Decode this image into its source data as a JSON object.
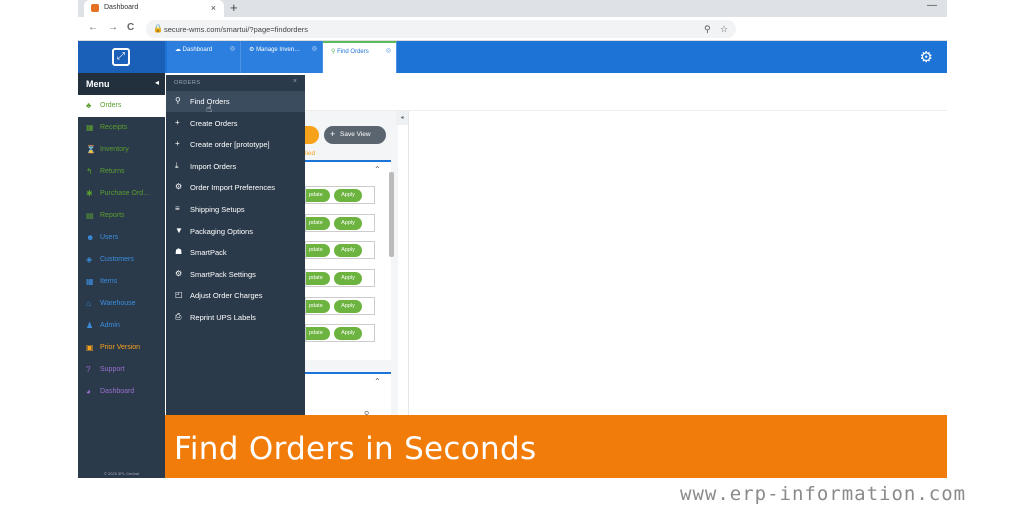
{
  "browser": {
    "tab_title": "Dashboard",
    "tab_close": "×",
    "new_tab": "+",
    "window_minimize": "—",
    "back": "←",
    "forward": "→",
    "reload": "C",
    "url": "secure-wms.com/smartui/?page=findorders",
    "lock_glyph": "🔒",
    "zoom_glyph": "⚲",
    "star_glyph": "☆"
  },
  "app": {
    "logo_glyph": "⤢",
    "tabs": [
      {
        "label": "Dashboard",
        "icon": "☁",
        "close": "◎"
      },
      {
        "label": "Manage Inven…",
        "icon": "⚙",
        "close": "◎"
      },
      {
        "label": "Find Orders",
        "icon": "⚲",
        "close": "◎"
      }
    ],
    "gear_glyph": "⚙"
  },
  "sidebar": {
    "title": "Menu",
    "collapse_glyph": "◂",
    "items": [
      {
        "label": "Orders",
        "icon": "♣",
        "color": "#5a9e2f"
      },
      {
        "label": "Receipts",
        "icon": "▦",
        "color": "#5a9e2f"
      },
      {
        "label": "Inventory",
        "icon": "⌛",
        "color": "#5a9e2f"
      },
      {
        "label": "Returns",
        "icon": "↰",
        "color": "#5a9e2f"
      },
      {
        "label": "Purchase Ord…",
        "icon": "✱",
        "color": "#5a9e2f"
      },
      {
        "label": "Reports",
        "icon": "▤",
        "color": "#5a9e2f"
      },
      {
        "label": "Users",
        "icon": "☻",
        "color": "#3a8fe0"
      },
      {
        "label": "Customers",
        "icon": "◈",
        "color": "#3a8fe0"
      },
      {
        "label": "Items",
        "icon": "▦",
        "color": "#3a8fe0"
      },
      {
        "label": "Warehouse",
        "icon": "⌂",
        "color": "#3a8fe0"
      },
      {
        "label": "Admin",
        "icon": "♟",
        "color": "#3a8fe0"
      },
      {
        "label": "Prior Version",
        "icon": "▣",
        "color": "#f7a21b"
      },
      {
        "label": "Support",
        "icon": "?",
        "color": "#9b6fd0"
      },
      {
        "label": "Dashboard",
        "icon": "◕",
        "color": "#9b6fd0"
      }
    ],
    "copyright": "© 2020 3PL Central"
  },
  "dropdown": {
    "header": "ORDERS",
    "close": "×",
    "items": [
      {
        "label": "Find Orders",
        "icon": "⚲"
      },
      {
        "label": "Create Orders",
        "icon": "+"
      },
      {
        "label": "Create order [prototype]",
        "icon": "+"
      },
      {
        "label": "Import Orders",
        "icon": "⤓"
      },
      {
        "label": "Order Import Preferences",
        "icon": "⚙"
      },
      {
        "label": "Shipping Setups",
        "icon": "≡"
      },
      {
        "label": "Packaging Options",
        "icon": "▼"
      },
      {
        "label": "SmartPack",
        "icon": "☗"
      },
      {
        "label": "SmartPack Settings",
        "icon": "⚙"
      },
      {
        "label": "Adjust Order Charges",
        "icon": "◰"
      },
      {
        "label": "Reprint UPS Labels",
        "icon": "⎙"
      }
    ],
    "cursor_glyph": "☝"
  },
  "main": {
    "save_view": "Save View",
    "save_view_plus": "+",
    "filtered": "lied",
    "collapse_glyph": "◂",
    "chevron_up": "⌃",
    "rows": [
      {
        "update": "pdate",
        "apply": "Apply"
      },
      {
        "update": "pdate",
        "apply": "Apply"
      },
      {
        "update": "pdate",
        "apply": "Apply"
      },
      {
        "update": "pdate",
        "apply": "Apply"
      },
      {
        "update": "pdate",
        "apply": "Apply"
      },
      {
        "update": "pdate",
        "apply": "Apply"
      }
    ],
    "search_glyph": "⚲"
  },
  "banner": {
    "text": "Find Orders in Seconds",
    "color": "#f27c0a"
  },
  "watermark": "www.erp-information.com"
}
